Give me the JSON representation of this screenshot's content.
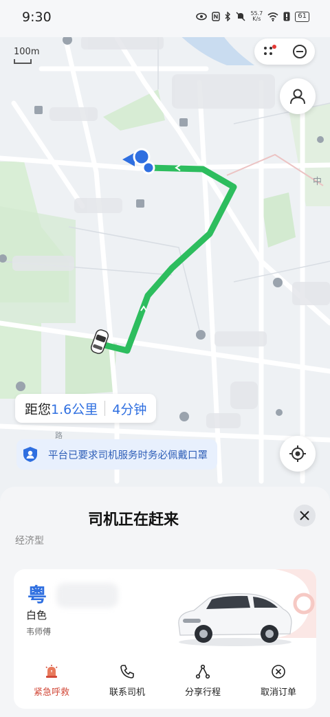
{
  "status_bar": {
    "time": "9:30",
    "net_speed_value": "55.7",
    "net_speed_unit": "K/s",
    "battery": "61"
  },
  "map": {
    "scale_label": "100m",
    "road_label": "中",
    "road_label_2": "路"
  },
  "eta": {
    "prefix": "距您",
    "distance": "1.6公里",
    "time": "4分钟"
  },
  "notice": {
    "text": "平台已要求司机服务时务必佩戴口罩"
  },
  "sheet": {
    "title": "司机正在赶来",
    "car_type": "经济型",
    "plate_prefix": "粤",
    "car_color": "白色",
    "driver_name": "韦师傅",
    "actions": [
      {
        "label": "紧急呼救",
        "icon": "sos-icon"
      },
      {
        "label": "联系司机",
        "icon": "phone-icon"
      },
      {
        "label": "分享行程",
        "icon": "share-icon"
      },
      {
        "label": "取消订单",
        "icon": "cancel-icon"
      }
    ]
  },
  "colors": {
    "route": "#2dbd5e",
    "accent_blue": "#2f6fe0",
    "sos_red": "#d24a3a"
  }
}
